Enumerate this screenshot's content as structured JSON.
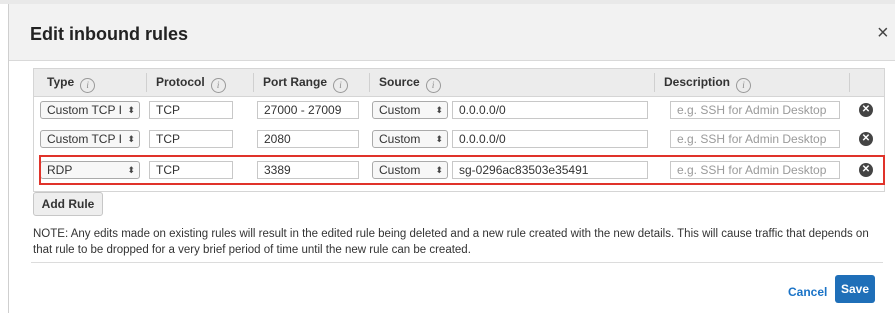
{
  "dialog": {
    "title": "Edit inbound rules",
    "close_glyph": "×"
  },
  "table": {
    "columns": {
      "type": "Type",
      "protocol": "Protocol",
      "port_range": "Port Range",
      "source": "Source",
      "description": "Description"
    },
    "info_glyph": "i",
    "caret_glyph": "⬍",
    "delete_glyph": "✕",
    "rows": [
      {
        "type": "Custom TCP I",
        "protocol": "TCP",
        "port_range": "27000 - 27009",
        "source_type": "Custom",
        "source_value": "0.0.0.0/0",
        "description_placeholder": "e.g. SSH for Admin Desktop"
      },
      {
        "type": "Custom TCP I",
        "protocol": "TCP",
        "port_range": "2080",
        "source_type": "Custom",
        "source_value": "0.0.0.0/0",
        "description_placeholder": "e.g. SSH for Admin Desktop"
      },
      {
        "type": "RDP",
        "protocol": "TCP",
        "port_range": "3389",
        "source_type": "Custom",
        "source_value": "sg-0296ac83503e35491",
        "description_placeholder": "e.g. SSH for Admin Desktop"
      }
    ]
  },
  "actions": {
    "add_rule": "Add Rule",
    "cancel": "Cancel",
    "save": "Save"
  },
  "note": "NOTE: Any edits made on existing rules will result in the edited rule being deleted and a new rule created with the new details. This will cause traffic that depends on that rule to be dropped for a very brief period of time until the new rule can be created.",
  "colors": {
    "highlight": "#e0332a",
    "primary": "#1f6fb8",
    "link": "#1a73c7"
  }
}
